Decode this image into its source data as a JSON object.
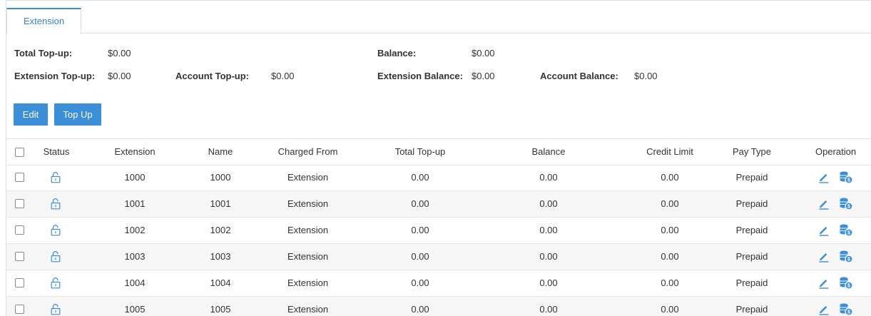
{
  "tabs": [
    {
      "label": "Extension",
      "active": true
    }
  ],
  "summary": {
    "total_topup_label": "Total Top-up:",
    "total_topup_value": "$0.00",
    "balance_label": "Balance:",
    "balance_value": "$0.00",
    "extension_topup_label": "Extension Top-up:",
    "extension_topup_value": "$0.00",
    "account_topup_label": "Account Top-up:",
    "account_topup_value": "$0.00",
    "extension_balance_label": "Extension Balance:",
    "extension_balance_value": "$0.00",
    "account_balance_label": "Account Balance:",
    "account_balance_value": "$0.00"
  },
  "toolbar": {
    "edit_label": "Edit",
    "topup_label": "Top Up"
  },
  "table": {
    "headers": [
      "Status",
      "Extension",
      "Name",
      "Charged From",
      "Total Top-up",
      "Balance",
      "Credit Limit",
      "Pay Type",
      "Operation"
    ],
    "rows": [
      {
        "status_icon": "unlock-icon",
        "extension": "1000",
        "name": "1000",
        "charged_from": "Extension",
        "total_topup": "0.00",
        "balance": "0.00",
        "credit_limit": "0.00",
        "pay_type": "Prepaid"
      },
      {
        "status_icon": "unlock-icon",
        "extension": "1001",
        "name": "1001",
        "charged_from": "Extension",
        "total_topup": "0.00",
        "balance": "0.00",
        "credit_limit": "0.00",
        "pay_type": "Prepaid"
      },
      {
        "status_icon": "unlock-icon",
        "extension": "1002",
        "name": "1002",
        "charged_from": "Extension",
        "total_topup": "0.00",
        "balance": "0.00",
        "credit_limit": "0.00",
        "pay_type": "Prepaid"
      },
      {
        "status_icon": "unlock-icon",
        "extension": "1003",
        "name": "1003",
        "charged_from": "Extension",
        "total_topup": "0.00",
        "balance": "0.00",
        "credit_limit": "0.00",
        "pay_type": "Prepaid"
      },
      {
        "status_icon": "unlock-icon",
        "extension": "1004",
        "name": "1004",
        "charged_from": "Extension",
        "total_topup": "0.00",
        "balance": "0.00",
        "credit_limit": "0.00",
        "pay_type": "Prepaid"
      },
      {
        "status_icon": "unlock-icon",
        "extension": "1005",
        "name": "1005",
        "charged_from": "Extension",
        "total_topup": "0.00",
        "balance": "0.00",
        "credit_limit": "0.00",
        "pay_type": "Prepaid"
      }
    ]
  },
  "icons": {
    "status": "unlock-icon",
    "edit": "pencil-icon",
    "topup": "coins-icon"
  },
  "colors": {
    "accent": "#3b8fd9",
    "row_alt": "#f6f6f6"
  }
}
